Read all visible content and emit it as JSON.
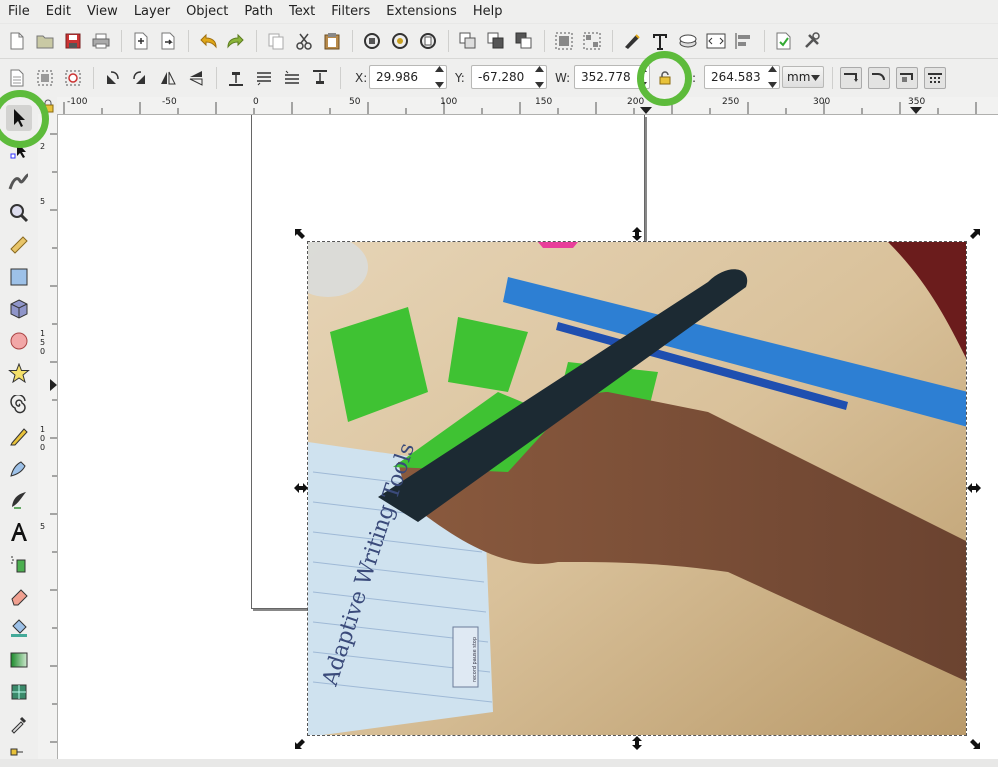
{
  "menu": [
    "File",
    "Edit",
    "View",
    "Layer",
    "Object",
    "Path",
    "Text",
    "Filters",
    "Extensions",
    "Help"
  ],
  "controls": {
    "x_label": "X:",
    "x_value": "29.986",
    "y_label": "Y:",
    "y_value": "-67.280",
    "w_label": "W:",
    "w_value": "352.778",
    "h_label": ":",
    "h_value": "264.583",
    "unit": "mm"
  },
  "ruler_h": [
    "-100",
    "-50",
    "0",
    "50",
    "100",
    "150",
    "200",
    "250",
    "300",
    "350"
  ],
  "ruler_v": [
    "2",
    "5",
    "1 5 0",
    "1 0 0",
    "5"
  ],
  "photo": {
    "handwriting": "Adaptive Writing Tools",
    "device_text": "record pause stop"
  },
  "colors": {
    "highlight_ring": "#5dbb3b",
    "green_plastic": "#3fc233",
    "ruler_blue": "#2d7fd3",
    "pen_black": "#1c2a33"
  }
}
